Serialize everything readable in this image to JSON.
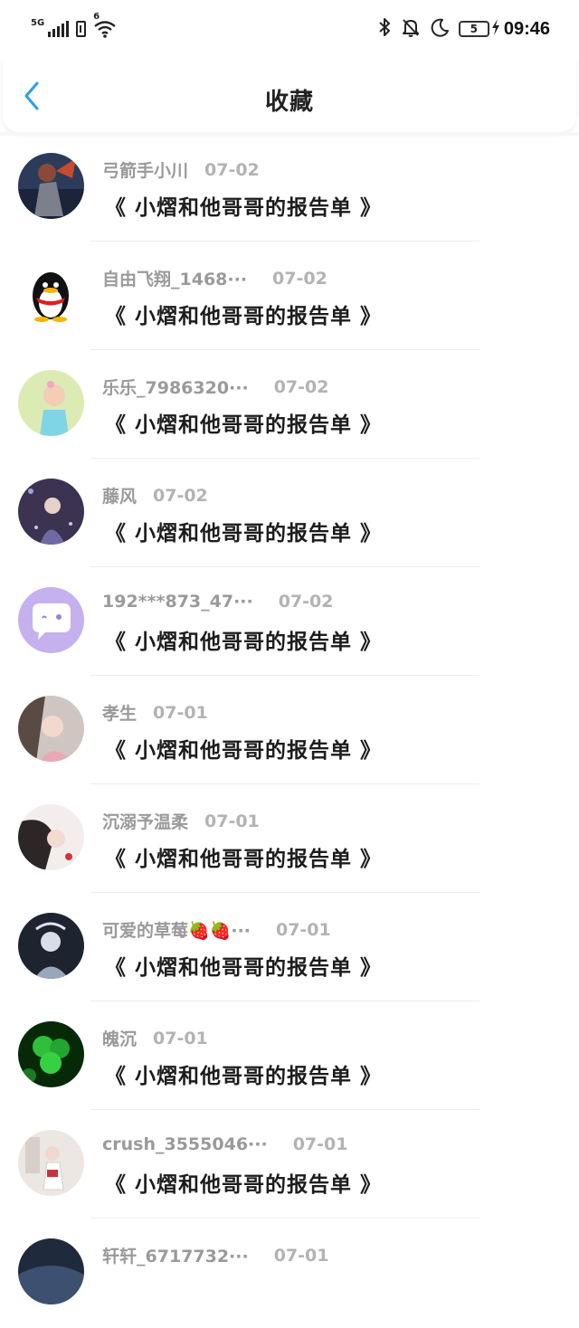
{
  "status_bar": {
    "network": "5G",
    "wifi_tag": "6",
    "battery_level": "5",
    "time": "09:46",
    "icons": [
      "signal-icon",
      "sim-icon",
      "wifi-icon",
      "bluetooth-icon",
      "mute-bell-icon",
      "moon-icon",
      "battery-icon",
      "charging-icon"
    ]
  },
  "header": {
    "title": "收藏",
    "back_icon": "chevron-left-icon",
    "accent": "#2b9bf4"
  },
  "favorites": [
    {
      "username": "弓箭手小川",
      "date": "07-02",
      "title": "《 小熠和他哥哥的报告单 》",
      "avatar": "avatar-warrior"
    },
    {
      "username": "自由飞翔_1468···",
      "date": "07-02",
      "title": "《 小熠和他哥哥的报告单 》",
      "avatar": "avatar-qq-penguin"
    },
    {
      "username": "乐乐_7986320···",
      "date": "07-02",
      "title": "《 小熠和他哥哥的报告单 》",
      "avatar": "avatar-baby"
    },
    {
      "username": "藤风",
      "date": "07-02",
      "title": "《 小熠和他哥哥的报告单 》",
      "avatar": "avatar-anime-girl"
    },
    {
      "username": "192***873_47···",
      "date": "07-02",
      "title": "《 小熠和他哥哥的报告单 》",
      "avatar": "avatar-chat-bubble"
    },
    {
      "username": "孝生",
      "date": "07-01",
      "title": "《 小熠和他哥哥的报告单 》",
      "avatar": "avatar-girl-pink"
    },
    {
      "username": "沉溺予温柔",
      "date": "07-01",
      "title": "《 小熠和他哥哥的报告单 》",
      "avatar": "avatar-girl-light"
    },
    {
      "username": "可爱的草莓🍓🍓···",
      "date": "07-01",
      "title": "《 小熠和他哥哥的报告单 》",
      "avatar": "avatar-girl-dark"
    },
    {
      "username": "魄沉",
      "date": "07-01",
      "title": "《 小熠和他哥哥的报告单 》",
      "avatar": "avatar-clover"
    },
    {
      "username": "crush_3555046···",
      "date": "07-01",
      "title": "《 小熠和他哥哥的报告单 》",
      "avatar": "avatar-girl-room"
    },
    {
      "username": "轩轩_6717732···",
      "date": "07-01",
      "title": "",
      "avatar": "avatar-dark-sky"
    }
  ]
}
